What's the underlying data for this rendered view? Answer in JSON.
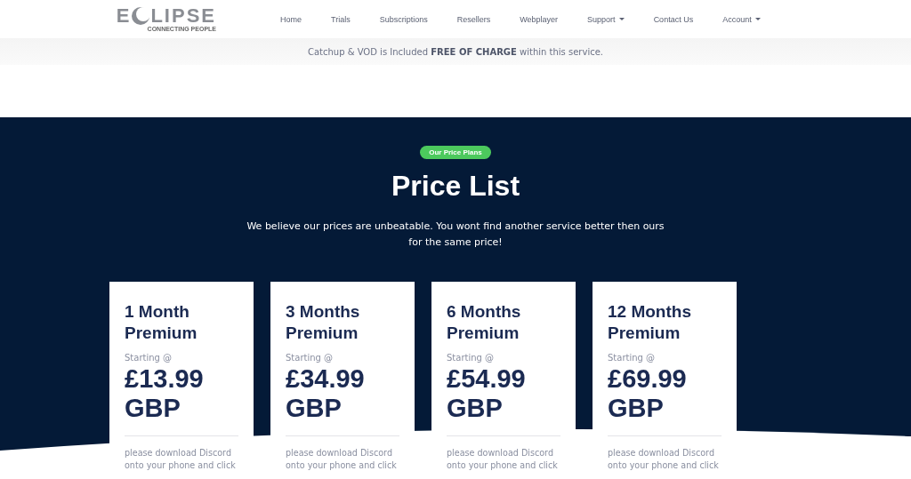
{
  "logo": {
    "text_before": "E",
    "text_after": "LIPSE",
    "tagline": "CONNECTING PEOPLE"
  },
  "nav": [
    {
      "label": "Home",
      "has_menu": false
    },
    {
      "label": "Trials",
      "has_menu": false
    },
    {
      "label": "Subscriptions",
      "has_menu": false
    },
    {
      "label": "Resellers",
      "has_menu": false
    },
    {
      "label": "Webplayer",
      "has_menu": false
    },
    {
      "label": "Support",
      "has_menu": true
    },
    {
      "label": "Contact Us",
      "has_menu": false
    },
    {
      "label": "Account",
      "has_menu": true
    }
  ],
  "notice": "Catchup & VOD is Included **FREE OF CHARGE** within this service.",
  "pricing": {
    "badge": "Our Price Plans",
    "title": "Price List",
    "intro": "We believe our prices are unbeatable. You wont find another service better then ours for the same price!",
    "plans": [
      {
        "name": "1 Month Premium",
        "starting": "Starting @",
        "price": "£13.99 GBP",
        "description": [
          "please download Discord",
          "onto your phone and click"
        ]
      },
      {
        "name": "3 Months Premium",
        "starting": "Starting @",
        "price": "£34.99 GBP",
        "description": [
          "please download Discord",
          "onto your phone and click"
        ]
      },
      {
        "name": "6 Months Premium",
        "starting": "Starting @",
        "price": "£54.99 GBP",
        "description": [
          "please download Discord",
          "onto your phone and click"
        ]
      },
      {
        "name": "12 Months Premium",
        "starting": "Starting @",
        "price": "£69.99 GBP",
        "description": [
          "please download Discord",
          "onto your phone and click"
        ]
      }
    ]
  }
}
